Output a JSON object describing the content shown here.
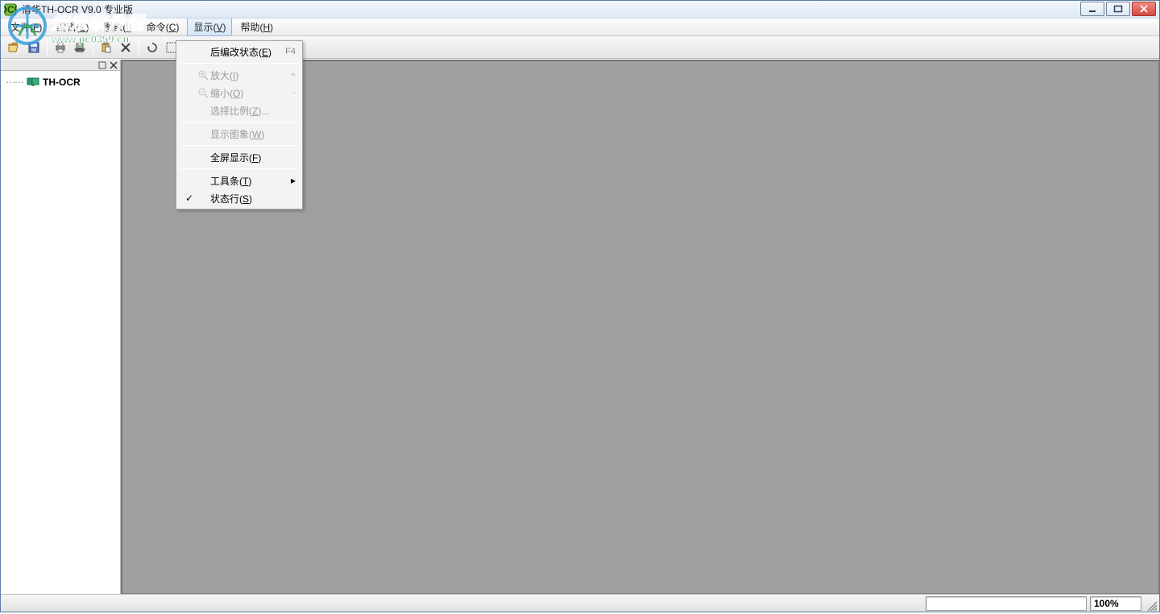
{
  "window": {
    "title": "清华TH-OCR V9.0 专业版"
  },
  "menubar": {
    "items": [
      {
        "label": "文件",
        "hotkey": "F"
      },
      {
        "label": "编辑",
        "hotkey": "E"
      },
      {
        "label": "图象",
        "hotkey": "I"
      },
      {
        "label": "命令",
        "hotkey": "C"
      },
      {
        "label": "显示",
        "hotkey": "V",
        "active": true
      },
      {
        "label": "帮助",
        "hotkey": "H"
      }
    ]
  },
  "toolbar": {
    "icons": [
      "open-icon",
      "save-icon",
      "sep",
      "print-icon",
      "scanner-icon",
      "sep",
      "paste-icon",
      "delete-icon",
      "sep",
      "rotate-left-icon",
      "region-icon",
      "auto-layout-icon",
      "ocr-icon",
      "sep",
      "doc-icon",
      "copy-icon"
    ]
  },
  "watermark": {
    "text": "知东软件园",
    "url": "www.pc0359.cn"
  },
  "side": {
    "tree_root": "TH-OCR"
  },
  "dropdown": {
    "items": [
      {
        "label": "后编改状态",
        "hotkey": "E",
        "shortcut": "F4",
        "icon": null,
        "enabled": true
      },
      {
        "sep": true
      },
      {
        "label": "放大",
        "hotkey": "I",
        "shortcut": "+",
        "icon": "zoom-in-icon",
        "enabled": false
      },
      {
        "label": "缩小",
        "hotkey": "O",
        "shortcut": "-",
        "icon": "zoom-out-icon",
        "enabled": false
      },
      {
        "label": "选择比例",
        "hotkey": "Z",
        "suffix": "...",
        "icon": null,
        "enabled": false
      },
      {
        "sep": true
      },
      {
        "label": "显示图象",
        "hotkey": "W",
        "icon": null,
        "enabled": false
      },
      {
        "sep": true
      },
      {
        "label": "全屏显示",
        "hotkey": "F",
        "icon": null,
        "enabled": true
      },
      {
        "sep": true
      },
      {
        "label": "工具条",
        "hotkey": "T",
        "icon": null,
        "enabled": true,
        "submenu": true
      },
      {
        "label": "状态行",
        "hotkey": "S",
        "icon": null,
        "enabled": true,
        "checked": true
      }
    ]
  },
  "statusbar": {
    "info": "",
    "zoom": "100%"
  }
}
